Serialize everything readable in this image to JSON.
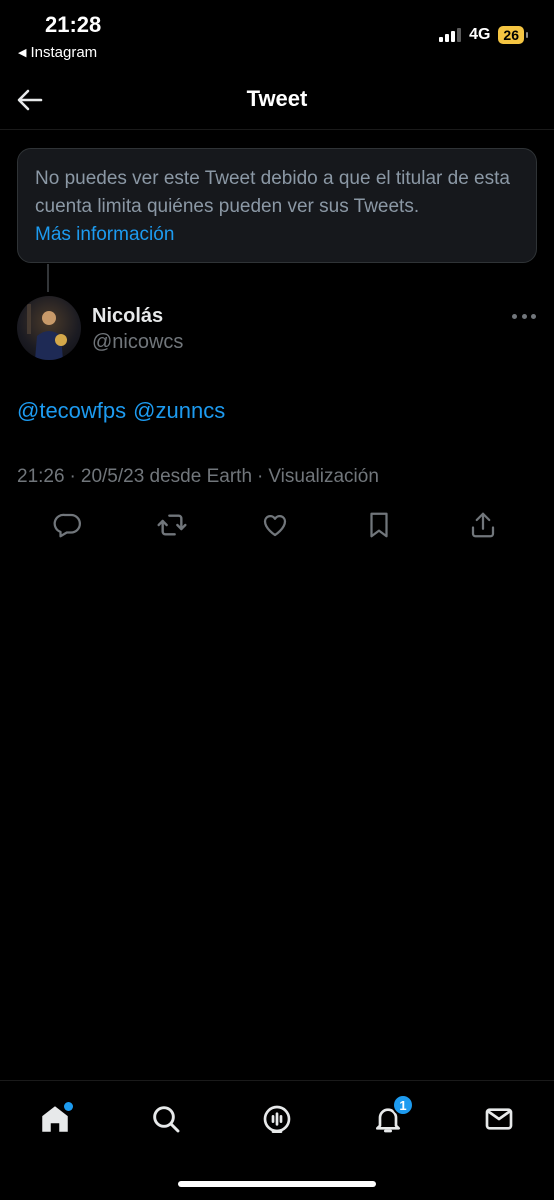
{
  "status_bar": {
    "time": "21:28",
    "back_app": "Instagram",
    "network": "4G",
    "battery": "26"
  },
  "header": {
    "title": "Tweet"
  },
  "notice": {
    "text": "No puedes ver este Tweet debido a que el titular de esta cuenta limita quiénes pueden ver sus Tweets.",
    "link": "Más información"
  },
  "tweet": {
    "display_name": "Nicolás",
    "username": "@nicowcs",
    "mentions": [
      "@tecowfps",
      "@zunncs"
    ],
    "time": "21:26",
    "date": "20/5/23 desde Earth",
    "views": "Visualización",
    "separator": "·"
  },
  "nav": {
    "notifications_badge": "1"
  },
  "colors": {
    "accent": "#1d9bf0",
    "background": "#000000",
    "secondary_text": "#71767b"
  }
}
